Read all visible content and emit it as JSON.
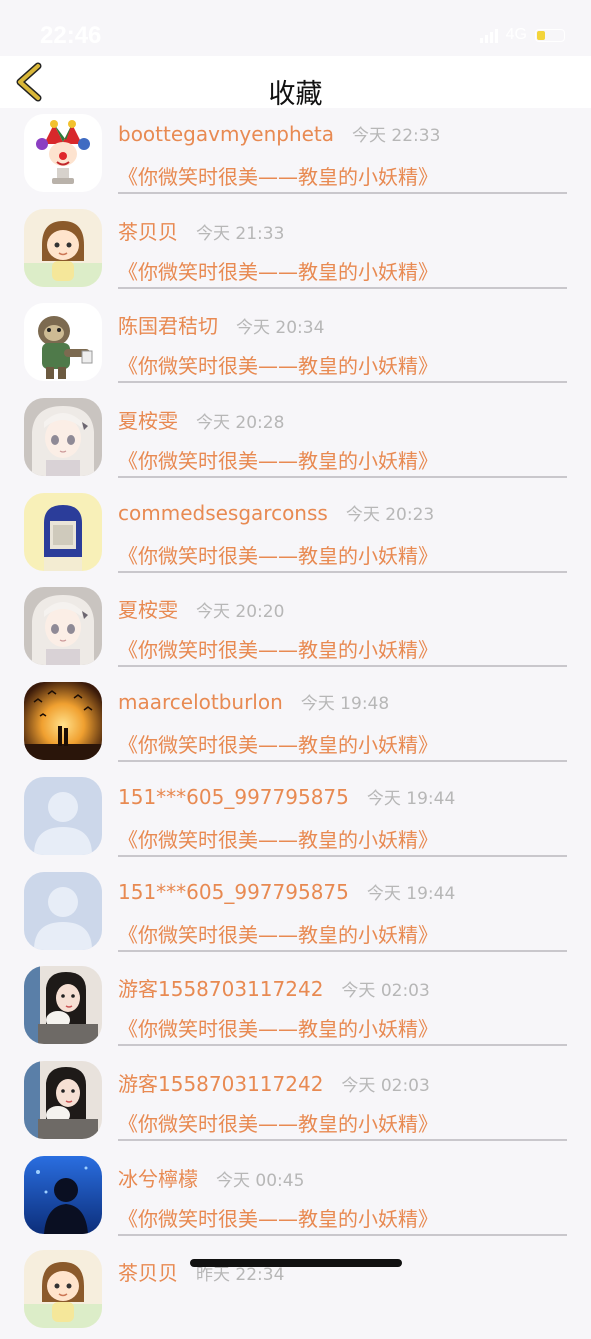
{
  "status_bar": {
    "time": "22:46",
    "network": "4G",
    "battery_color": "#f3d43a"
  },
  "nav": {
    "title": "收藏",
    "back_icon": "chevron-left-icon",
    "back_color": "#c8a72b"
  },
  "items": [
    {
      "username": "boottegavmyenpheta",
      "time": "今天 22:33",
      "work": "《你微笑时很美——教皇的小妖精》",
      "avatar": "jester-clown"
    },
    {
      "username": "茶贝贝",
      "time": "今天 21:33",
      "work": "《你微笑时很美——教皇的小妖精》",
      "avatar": "cartoon-girl"
    },
    {
      "username": "陈国君秸切",
      "time": "今天 20:34",
      "work": "《你微笑时很美——教皇的小妖精》",
      "avatar": "sloth"
    },
    {
      "username": "夏桉雯",
      "time": "今天 20:28",
      "work": "《你微笑时很美——教皇的小妖精》",
      "avatar": "anime-girl-white-hair"
    },
    {
      "username": "commedsesgarconss",
      "time": "今天 20:23",
      "work": "《你微笑时很美——教皇的小妖精》",
      "avatar": "blue-hair-girl"
    },
    {
      "username": "夏桉雯",
      "time": "今天 20:20",
      "work": "《你微笑时很美——教皇的小妖精》",
      "avatar": "anime-girl-white-hair"
    },
    {
      "username": "maarcelotburlon",
      "time": "今天 19:48",
      "work": "《你微笑时很美——教皇的小妖精》",
      "avatar": "sunset-birds"
    },
    {
      "username": "151***605_997795875",
      "time": "今天 19:44",
      "work": "《你微笑时很美——教皇的小妖精》",
      "avatar": "default-user"
    },
    {
      "username": "151***605_997795875",
      "time": "今天 19:44",
      "work": "《你微笑时很美——教皇的小妖精》",
      "avatar": "default-user"
    },
    {
      "username": "游客1558703117242",
      "time": "今天 02:03",
      "work": "《你微笑时很美——教皇的小妖精》",
      "avatar": "girl-with-cat"
    },
    {
      "username": "游客1558703117242",
      "time": "今天 02:03",
      "work": "《你微笑时很美——教皇的小妖精》",
      "avatar": "girl-with-cat"
    },
    {
      "username": "冰兮檸檬",
      "time": "今天 00:45",
      "work": "《你微笑时很美——教皇的小妖精》",
      "avatar": "silhouette-blue"
    },
    {
      "username": "茶贝贝",
      "time": "昨天 22:34",
      "work": "",
      "avatar": "cartoon-girl"
    }
  ],
  "colors": {
    "accent": "#e88a52",
    "timestamp": "#b7b7b7",
    "background": "#f7f6f9"
  }
}
